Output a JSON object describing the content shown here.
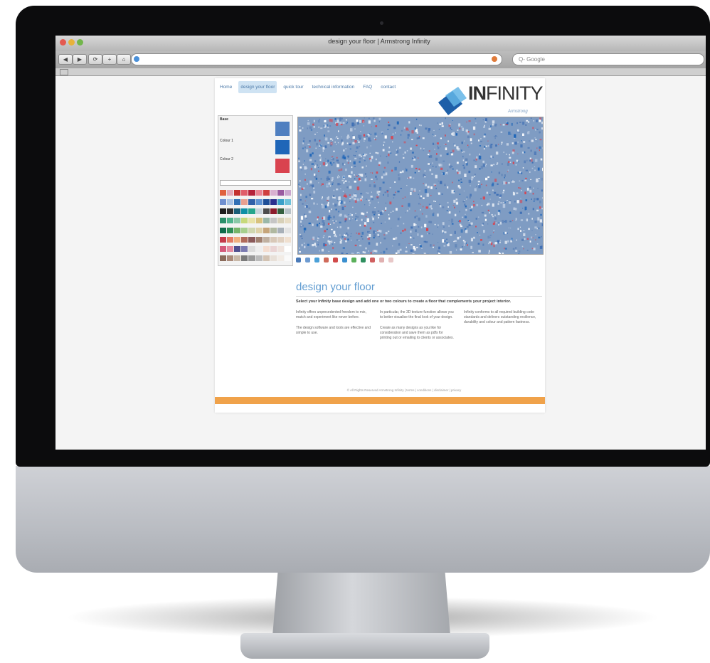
{
  "window": {
    "title": "design your floor | Armstrong Infinity",
    "search_placeholder": "Q- Google"
  },
  "nav": {
    "items": [
      "Home",
      "design your floor",
      "quick tour",
      "technical information",
      "FAQ",
      "contact"
    ],
    "active_index": 1
  },
  "brand": {
    "logo_bold": "IN",
    "logo_rest": "FINITY",
    "sub": "Armstrong"
  },
  "designer": {
    "base_label": "Base",
    "colour1_label": "Colour 1",
    "colour2_label": "Colour 2",
    "base_color": "#4f7fc0",
    "colour1_color": "#1f66b8",
    "colour2_color": "#d9434f",
    "floor_base_color": "#7f9cc3"
  },
  "content": {
    "heading": "design your floor",
    "intro": "Select your Infinity base design and add one or two colours to create a floor that complements your project interior.",
    "col1": [
      "Infinity offers unprecedented freedom to mix, match and experiment like never before.",
      "The design software and tools are effective and simple to use."
    ],
    "col2": [
      "In particular, the 3D texture function allows you to better visualise the final look of your design.",
      "Create as many designs as you like for consideration and save them as pdfs for printing out or emailing to clients or associates."
    ],
    "col3": [
      "Infinity conforms to all required building code standards and delivers outstanding resilience, durability and colour and pattern fastness."
    ]
  },
  "footer": {
    "text": "© All Rights Reserved Armstrong Infinity  |  terms  |  conditions  |  disclaimer  |  privacy"
  },
  "colors": {
    "accent": "#5f9bd0",
    "footer_bar": "#f0a24a",
    "nav_text": "#4b79a8"
  }
}
